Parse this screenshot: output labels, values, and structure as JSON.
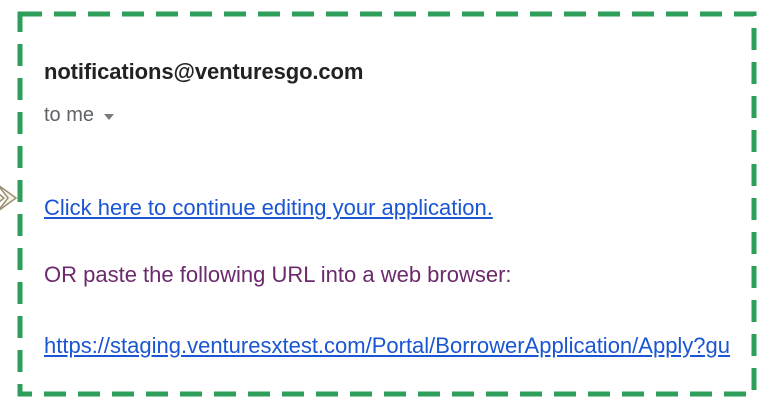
{
  "email": {
    "sender": "notifications@venturesgo.com",
    "recipient": "to me",
    "continue_link": "Click here to continue editing your application.",
    "instruction": "OR paste the following URL into a web browser:",
    "url": "https://staging.venturesxtest.com/Portal/BorrowerApplication/Apply?gu"
  },
  "icons": {
    "recipient_dropdown": "caret-down-icon",
    "callout_arrow": "arrow-pointer-icon"
  },
  "colors": {
    "frame_dash": "#2e9e5b",
    "link": "#1a55d3",
    "instruction_text": "#6b2a6b",
    "sender_text": "#222222",
    "meta_text": "#5f6368"
  }
}
